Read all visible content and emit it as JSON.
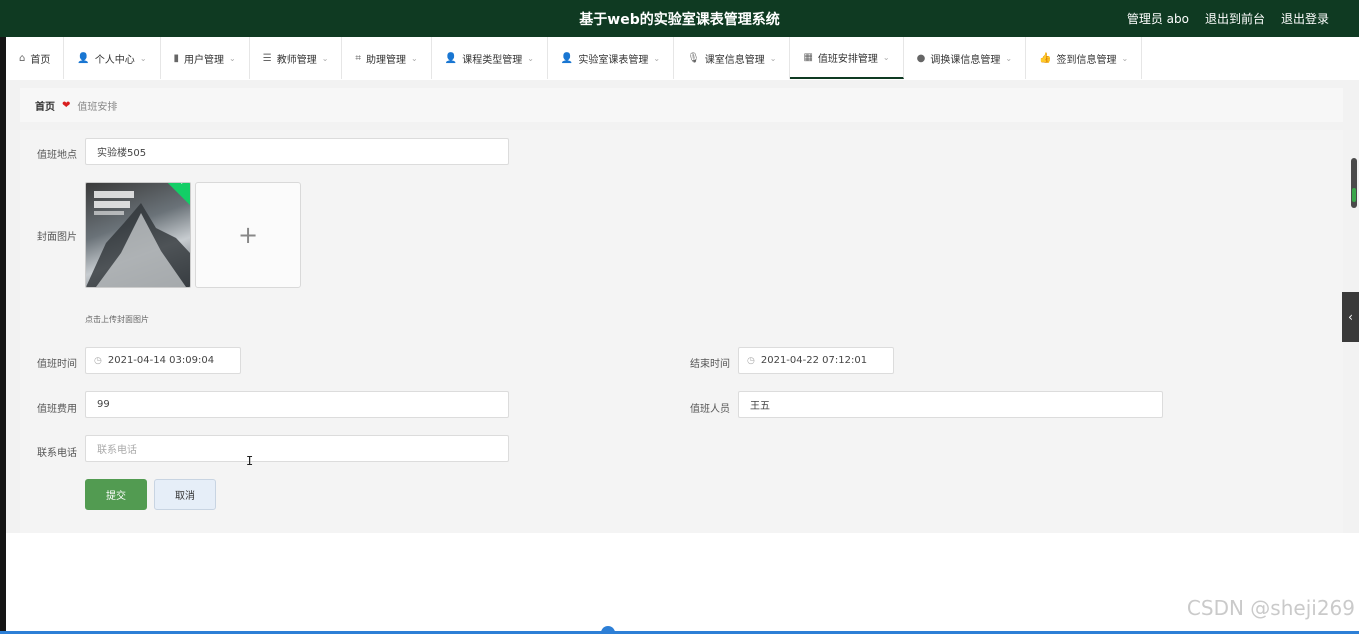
{
  "header": {
    "title": "基于web的实验室课表管理系统",
    "admin_label": "管理员 abo",
    "back_to_front": "退出到前台",
    "logout": "退出登录"
  },
  "nav": {
    "items": [
      {
        "label": "首页",
        "icon": "home-icon"
      },
      {
        "label": "个人中心",
        "icon": "person-icon"
      },
      {
        "label": "用户管理",
        "icon": "bar-chart-icon"
      },
      {
        "label": "教师管理",
        "icon": "list-icon"
      },
      {
        "label": "助理管理",
        "icon": "crop-icon"
      },
      {
        "label": "课程类型管理",
        "icon": "person-icon"
      },
      {
        "label": "实验室课表管理",
        "icon": "person-icon"
      },
      {
        "label": "课室信息管理",
        "icon": "microphone-icon"
      },
      {
        "label": "值班安排管理",
        "icon": "grid-icon"
      },
      {
        "label": "调换课信息管理",
        "icon": "location-pin-icon"
      },
      {
        "label": "签到信息管理",
        "icon": "thumbs-up-icon"
      }
    ],
    "active_index": 8
  },
  "breadcrumb": {
    "home": "首页",
    "current": "值班安排"
  },
  "form": {
    "location_label": "值班地点",
    "location_value": "实验楼505",
    "cover_label": "封面图片",
    "cover_hint": "点击上传封面图片",
    "start_label": "值班时间",
    "start_value": "2021-04-14 03:09:04",
    "end_label": "结束时间",
    "end_value": "2021-04-22 07:12:01",
    "fee_label": "值班费用",
    "fee_value": "99",
    "staff_label": "值班人员",
    "staff_value": "王五",
    "phone_label": "联系电话",
    "phone_placeholder": "联系电话",
    "submit_label": "提交",
    "cancel_label": "取消"
  },
  "watermark": "CSDN @sheji269",
  "colors": {
    "header_bg": "#0f3a22",
    "submit_bg": "#529b51",
    "heart": "#d81e1e",
    "upload_success": "#13ce66"
  }
}
